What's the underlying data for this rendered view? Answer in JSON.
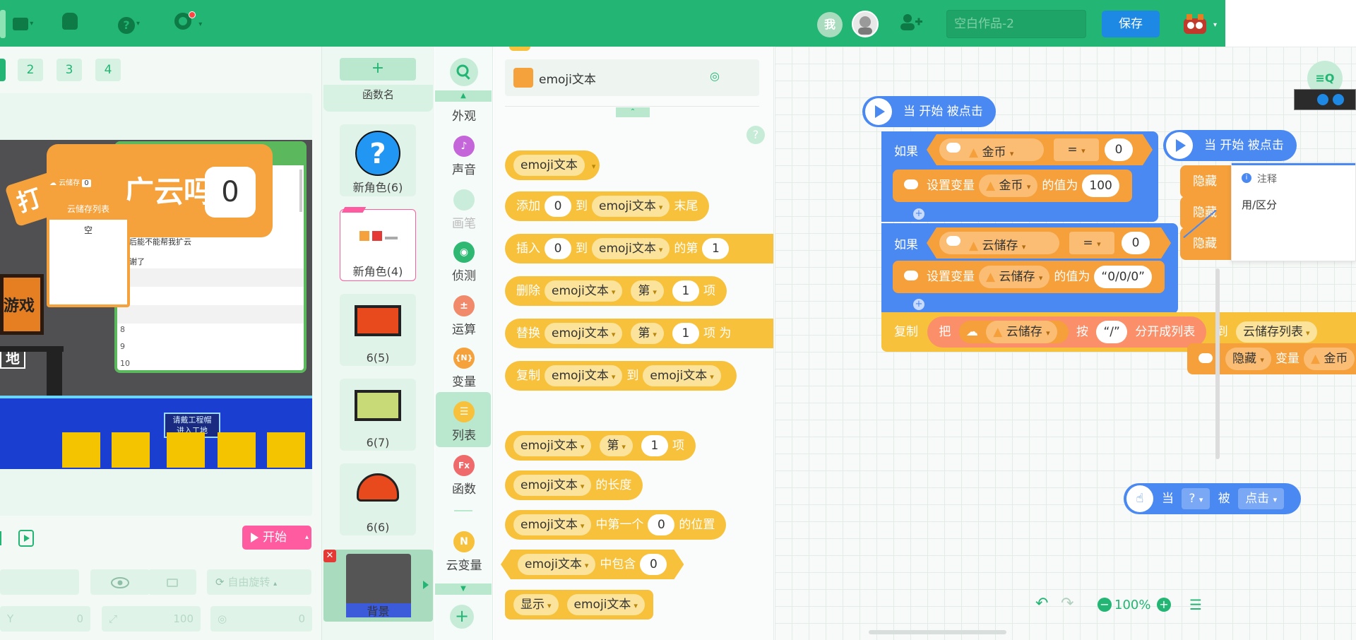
{
  "topbar": {
    "me_label": "我",
    "project_title_placeholder": "空白作品-2",
    "save_label": "保存"
  },
  "stage": {
    "tabs": [
      "2",
      "3",
      "4"
    ],
    "start_label": "开始",
    "rotation_label": "自由旋转",
    "y_label": "Y",
    "y_value": "0",
    "size_value": "100",
    "direction_value": "0",
    "overlay": {
      "banner_text": "广云吗",
      "banner_value": "0",
      "cloud_var_label": "云储存",
      "cloud_var_value": "0",
      "list_title": "云储存列表",
      "list_empty": "空",
      "chat_line1": "然后能不能帮我扩云",
      "chat_line2": "谢谢了",
      "rows": [
        "8",
        "9",
        "10"
      ],
      "game_text": "游戏",
      "ground_text": "地",
      "sign_line1": "请戴工程帽",
      "sign_line2": "进入工地"
    }
  },
  "sprites": {
    "add_label": "+",
    "partial_label": "函数名",
    "items": [
      {
        "label": "新角色(6)"
      },
      {
        "label": "新角色(4)"
      },
      {
        "label": "6(5)"
      },
      {
        "label": "6(7)"
      },
      {
        "label": "6(6)"
      }
    ],
    "backdrop_label": "背景"
  },
  "categories": {
    "items": [
      {
        "label": "外观"
      },
      {
        "label": "声音"
      },
      {
        "label": "画笔"
      },
      {
        "label": "侦测"
      },
      {
        "label": "运算"
      },
      {
        "label": "变量"
      },
      {
        "label": "列表"
      },
      {
        "label": "函数"
      },
      {
        "label": "云变量"
      }
    ],
    "icons": {
      "variable": "{N}",
      "function": "Fx",
      "cloud": "N"
    }
  },
  "palette": {
    "list_name": "emoji文本",
    "help_label": "?",
    "blocks": {
      "reporter": "emoji文本",
      "add": {
        "verb": "添加",
        "value": "0",
        "to": "到",
        "list": "emoji文本",
        "tail": "末尾"
      },
      "insert": {
        "verb": "插入",
        "value": "0",
        "to": "到",
        "list": "emoji文本",
        "of": "的第",
        "index": "1"
      },
      "delete": {
        "verb": "删除",
        "list": "emoji文本",
        "nth": "第",
        "index": "1",
        "item": "项"
      },
      "replace": {
        "verb": "替换",
        "list": "emoji文本",
        "nth": "第",
        "index": "1",
        "item": "项",
        "with": "为"
      },
      "copy": {
        "verb": "复制",
        "list": "emoji文本",
        "to": "到",
        "target": "emoji文本"
      },
      "item_of": {
        "list": "emoji文本",
        "nth": "第",
        "index": "1",
        "item": "项"
      },
      "length": {
        "list": "emoji文本",
        "suffix": "的长度"
      },
      "index_of": {
        "list": "emoji文本",
        "mid": "中第一个",
        "value": "0",
        "suffix": "的位置"
      },
      "contains": {
        "list": "emoji文本",
        "mid": "中包含",
        "value": "0"
      },
      "show": {
        "verb": "显示",
        "list": "emoji文本"
      }
    }
  },
  "workspace": {
    "event1": "当 开始 被点击",
    "event2": "当 开始 被点击",
    "if_label": "如果",
    "if1": {
      "var": "金币",
      "op": "=",
      "value": "0"
    },
    "set1": {
      "label": "设置变量",
      "var": "金币",
      "suffix": "的值为",
      "value": "100"
    },
    "if2": {
      "var": "云储存",
      "op": "=",
      "value": "0"
    },
    "set2": {
      "label": "设置变量",
      "var": "云储存",
      "suffix": "的值为",
      "value": "“0/0/0”"
    },
    "copy": {
      "verb": "复制",
      "ba": "把",
      "var": "云储存",
      "by": "按",
      "sep": "“/”",
      "split": "分开成列表",
      "to": "到",
      "target": "云储存列表"
    },
    "hide_label": "隐藏",
    "hide_var_label": "变量",
    "hide_var": "金币",
    "click_event": {
      "when": "当",
      "target": "?",
      "is": "被",
      "action": "点击"
    },
    "note_title": "注释",
    "note_body": "用/区分",
    "zoom": "100%"
  }
}
